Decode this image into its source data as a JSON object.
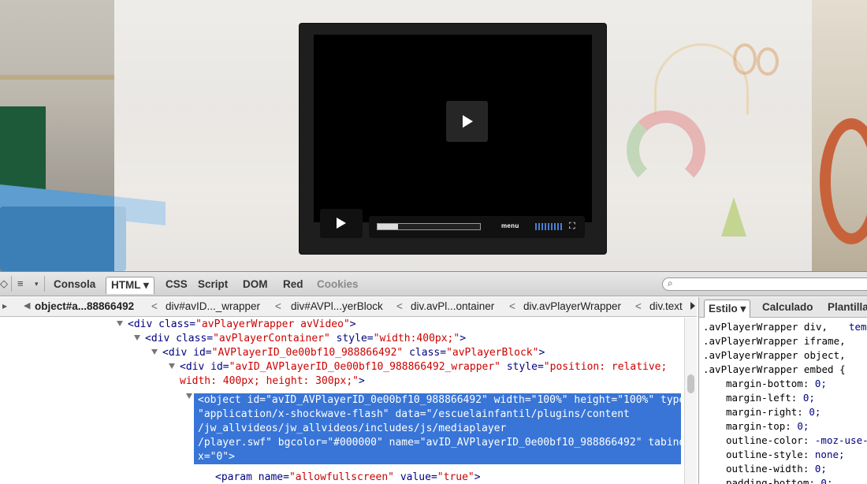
{
  "player": {
    "menu_label": "menu",
    "fullscreen_icon": "⛶",
    "progress": 0.2
  },
  "devtools": {
    "tabs": [
      "Consola",
      "HTML ▾",
      "CSS",
      "Script",
      "DOM",
      "Red",
      "Cookies"
    ],
    "search_icon": "⌕",
    "breadcrumb": [
      "object#a...88866492",
      "div#avID..._wrapper",
      "div#AVPl...yerBlock",
      "div.avPl...ontainer",
      "div.avPlayerWrapper",
      "div.text"
    ],
    "html_lines": [
      {
        "pre": "<div ",
        "a1": "class=",
        "v1": "\"avPlayerWrapper avVideo\"",
        "post": ">"
      },
      {
        "pre": "<div ",
        "a1": "class=",
        "v1": "\"avPlayerContainer\"",
        "a2": " style=",
        "v2": "\"width:400px;\"",
        "post": ">"
      },
      {
        "pre": "<div ",
        "a1": "id=",
        "v1": "\"AVPlayerID_0e00bf10_988866492\"",
        "a2": " class=",
        "v2": "\"avPlayerBlock\"",
        "post": ">"
      },
      {
        "pre": "<div ",
        "a1": "id=",
        "v1": "\"avID_AVPlayerID_0e00bf10_988866492_wrapper\"",
        "a2": " style=",
        "v2": "\"position: relative;",
        "post": ""
      },
      {
        "pre": "",
        "a1": "",
        "v1": "width: 400px; height: 300px;\"",
        "post": ">"
      }
    ],
    "selected_lines": [
      "<object id=\"avID_AVPlayerID_0e00bf10_988866492\" width=\"100%\" height=\"100%\" type=",
      "\"application/x-shockwave-flash\" data=\"/escuelainfantil/plugins/content",
      "/jw_allvideos/jw_allvideos/includes/js/mediaplayer",
      "/player.swf\" bgcolor=\"#000000\" name=\"avID_AVPlayerID_0e00bf10_988866492\" tabinde",
      "x=\"0\">"
    ],
    "param_line": {
      "pre": "<param ",
      "a1": "name=",
      "v1": "\"allowfullscreen\"",
      "a2": " value=",
      "v2": "\"true\"",
      "post": ">"
    },
    "style_tabs": [
      "Estilo ▾",
      "Calculado",
      "Plantilla"
    ],
    "style_lines": [
      {
        "text": ".avPlayerWrapper div,",
        "extra": "tem"
      },
      {
        "text": ".avPlayerWrapper iframe,"
      },
      {
        "text": ".avPlayerWrapper object,"
      },
      {
        "text": ".avPlayerWrapper embed {"
      },
      {
        "prop": "margin-bottom:",
        "val": "0;"
      },
      {
        "prop": "margin-left:",
        "val": "0;"
      },
      {
        "prop": "margin-right:",
        "val": "0;"
      },
      {
        "prop": "margin-top:",
        "val": "0;"
      },
      {
        "prop": "outline-color:",
        "val": "-moz-use-"
      },
      {
        "prop": "outline-style:",
        "val": "none;"
      },
      {
        "prop": "outline-width:",
        "val": "0;"
      },
      {
        "prop": "padding-bottom:",
        "val": "0;"
      }
    ]
  }
}
